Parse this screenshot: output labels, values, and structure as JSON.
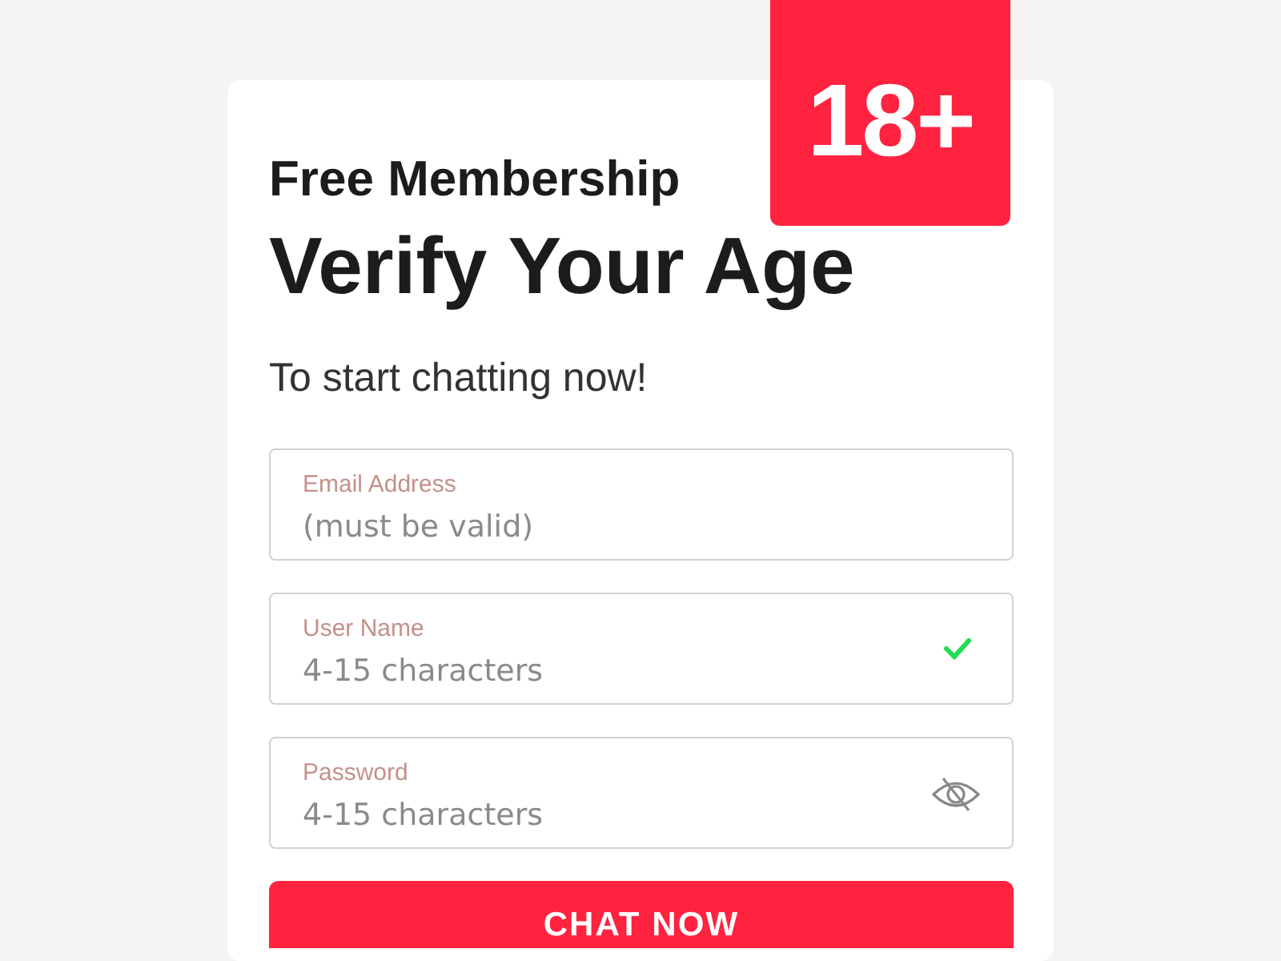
{
  "badge": "18+",
  "kicker": "Free Membership",
  "title": "Verify Your Age",
  "subtitle": "To start chatting now!",
  "fields": [
    {
      "kind": "text",
      "label": "Email Address",
      "placeholder": "(must be valid)",
      "valid": false
    },
    {
      "kind": "text",
      "label": "User Name",
      "placeholder": "4-15 characters",
      "valid": true
    },
    {
      "kind": "password",
      "label": "Password",
      "placeholder": "4-15 characters",
      "valid": false
    }
  ],
  "button": "CHAT NOW"
}
